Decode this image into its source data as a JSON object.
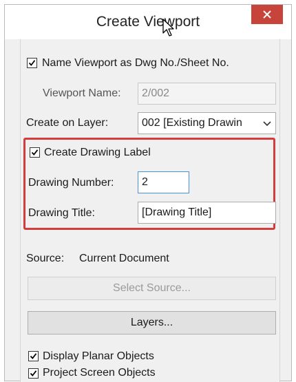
{
  "dialog": {
    "title": "Create Viewport",
    "close_icon": "close-icon"
  },
  "viewport": {
    "name_as_dwg_checked": true,
    "name_as_dwg_label": "Name Viewport as Dwg No./Sheet No.",
    "name_label": "Viewport Name:",
    "name_value": "2/002",
    "layer_label": "Create on Layer:",
    "layer_value": "002 [Existing Drawin"
  },
  "drawing_label": {
    "create_checked": true,
    "create_label": "Create Drawing Label",
    "number_label": "Drawing Number:",
    "number_value": "2",
    "title_label": "Drawing Title:",
    "title_value": "[Drawing Title]"
  },
  "source": {
    "label": "Source:",
    "value": "Current Document",
    "select_button": "Select Source...",
    "layers_button": "Layers..."
  },
  "options": {
    "display_planar_checked": true,
    "display_planar_label": "Display Planar Objects",
    "project_screen_checked": true,
    "project_screen_label": "Project Screen Objects"
  },
  "colors": {
    "highlight": "#d43c3c",
    "close_button": "#c7443a"
  }
}
